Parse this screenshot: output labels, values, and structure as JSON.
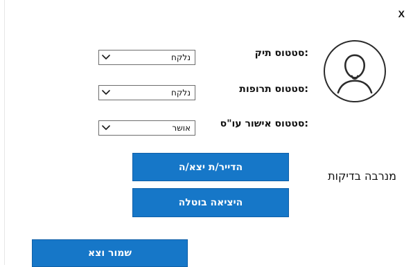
{
  "close": {
    "label": "X"
  },
  "patient": {
    "name": "מנרבה בדיקות"
  },
  "fields": [
    {
      "label": "סטטוס תיק:",
      "value": "נלקח"
    },
    {
      "label": "סטטוס תרופות:",
      "value": "נלקח"
    },
    {
      "label": "סטטוס אישור עו\"ס:",
      "value": "אושר"
    }
  ],
  "buttons": {
    "departure": "הדייר/ת יצא/ה",
    "cancel_departure": "היציאה בוטלה",
    "save_exit": "שמור וצא"
  },
  "colors": {
    "primary_button": "#1677c8",
    "primary_button_border": "#0f5fa8",
    "text": "#111111",
    "select_border": "#6d6d6d"
  },
  "icons": {
    "avatar": "user-avatar-icon",
    "chevron": "chevron-down-icon"
  }
}
